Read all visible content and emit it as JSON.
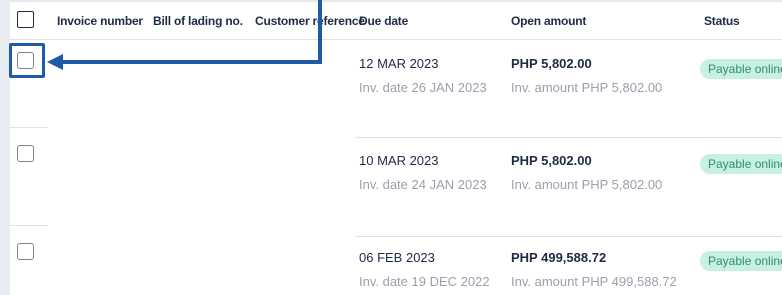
{
  "columns": {
    "invoice_number": "Invoice number",
    "bill_of_lading": "Bill of lading no.",
    "customer_reference": "Customer reference",
    "due_date": "Due date",
    "open_amount": "Open amount",
    "status": "Status"
  },
  "rows": [
    {
      "due_date": "12 MAR 2023",
      "inv_date": "Inv. date 26 JAN 2023",
      "open_amount": "PHP 5,802.00",
      "inv_amount": "Inv. amount PHP 5,802.00",
      "status": "Payable online"
    },
    {
      "due_date": "10 MAR 2023",
      "inv_date": "Inv. date 24 JAN 2023",
      "open_amount": "PHP 5,802.00",
      "inv_amount": "Inv. amount PHP 5,802.00",
      "status": "Payable online"
    },
    {
      "due_date": "06 FEB 2023",
      "inv_date": "Inv. date 19 DEC 2022",
      "open_amount": "PHP 499,588.72",
      "inv_amount": "Inv. amount PHP 499,588.72",
      "status": "Payable online"
    }
  ],
  "colors": {
    "annotation": "#1e5aa8",
    "badge_bg": "#c8efe3",
    "badge_text": "#2f8f6e"
  },
  "annotation": {
    "icon": "arrow-left-icon"
  }
}
